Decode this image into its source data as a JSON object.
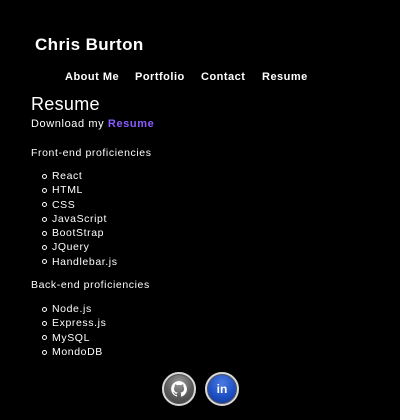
{
  "header": {
    "site_title": "Chris Burton"
  },
  "nav": {
    "items": [
      {
        "label": "About Me"
      },
      {
        "label": "Portfolio"
      },
      {
        "label": "Contact"
      },
      {
        "label": "Resume"
      }
    ]
  },
  "main": {
    "heading": "Resume",
    "download_prefix": "Download my",
    "download_link": "Resume",
    "frontend": {
      "label": "Front-end proficiencies",
      "items": [
        "React",
        "HTML",
        "CSS",
        "JavaScript",
        "BootStrap",
        "JQuery",
        "Handlebar.js"
      ]
    },
    "backend": {
      "label": "Back-end proficiencies",
      "items": [
        "Node.js",
        "Express.js",
        "MySQL",
        "MondoDB"
      ]
    }
  },
  "footer": {
    "social": [
      {
        "icon": "github-icon"
      },
      {
        "icon": "linkedin-icon",
        "text": "in"
      }
    ]
  },
  "colors": {
    "background": "#000000",
    "text": "#ffffff",
    "link_accent": "#8a5cff",
    "linkedin_blue": "#1d4fc4"
  }
}
